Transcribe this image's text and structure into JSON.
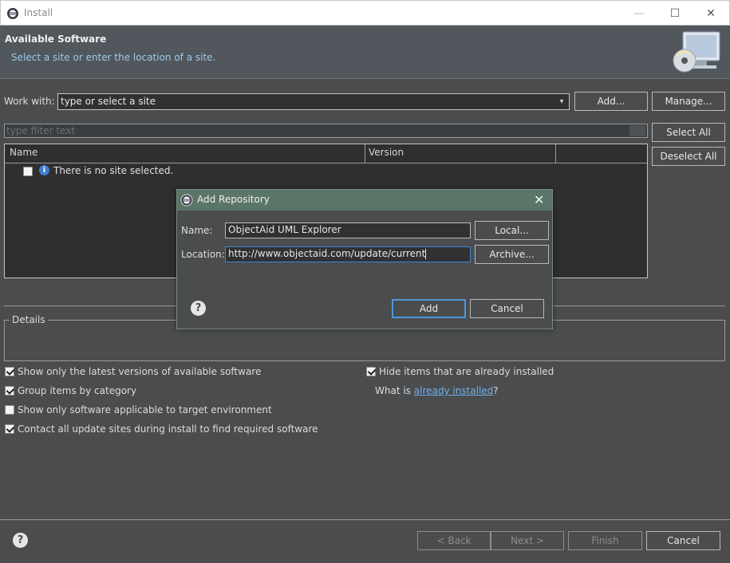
{
  "window": {
    "title": "Install",
    "minimize_glyph": "—",
    "maximize_glyph": "☐",
    "close_glyph": "✕"
  },
  "header": {
    "title": "Available Software",
    "subtitle": "Select a site or enter the location of a site."
  },
  "work_with": {
    "label": "Work with:",
    "value": "type or select a site",
    "add_button": "Add...",
    "manage_button": "Manage..."
  },
  "filter": {
    "placeholder": "type filter text"
  },
  "selection_buttons": {
    "select_all": "Select All",
    "deselect_all": "Deselect All"
  },
  "table": {
    "columns": [
      "Name",
      "Version"
    ],
    "rows": [
      {
        "checked": false,
        "text": "There is no site selected."
      }
    ]
  },
  "details": {
    "legend": "Details"
  },
  "options": {
    "latest_versions": {
      "label": "Show only the latest versions of available software",
      "checked": true
    },
    "group_by_category": {
      "label": "Group items by category",
      "checked": true
    },
    "applicable_only": {
      "label": "Show only software applicable to target environment",
      "checked": false
    },
    "contact_all_sites": {
      "label": "Contact all update sites during install to find required software",
      "checked": true
    },
    "hide_installed": {
      "label": "Hide items that are already installed",
      "checked": true
    },
    "what_is_prefix": "What is ",
    "what_is_link": "already installed",
    "what_is_suffix": "?"
  },
  "footer": {
    "back": "< Back",
    "next": "Next >",
    "finish": "Finish",
    "cancel": "Cancel"
  },
  "dialog": {
    "title": "Add Repository",
    "name_label": "Name:",
    "name_value": "ObjectAid UML Explorer",
    "location_label": "Location:",
    "location_value": "http://www.objectaid.com/update/current",
    "local_button": "Local...",
    "archive_button": "Archive...",
    "add_button": "Add",
    "cancel_button": "Cancel",
    "close_glyph": "✕"
  },
  "help_glyph": "?",
  "info_glyph": "i",
  "dropdown_glyph": "▾"
}
